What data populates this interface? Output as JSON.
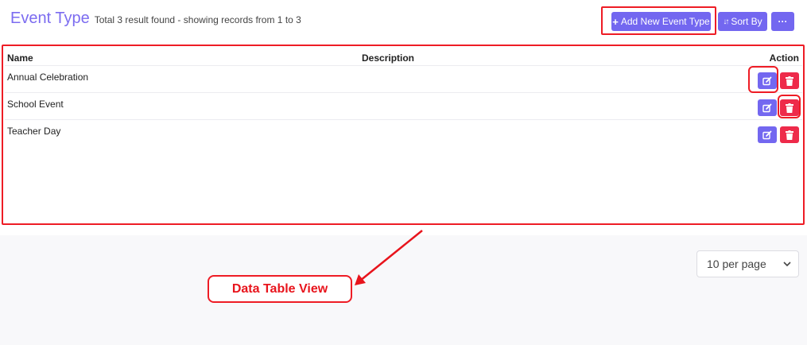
{
  "header": {
    "title": "Event Type",
    "summary": "Total 3 result found - showing records from 1 to 3"
  },
  "toolbar": {
    "add_icon": "+",
    "add_label": "Add New Event Type",
    "sort_icon": "↓↑",
    "sort_label": "Sort By",
    "more_label": "···"
  },
  "table": {
    "columns": {
      "name": "Name",
      "description": "Description",
      "action": "Action"
    },
    "rows": [
      {
        "name": "Annual Celebration",
        "description": ""
      },
      {
        "name": "School Event",
        "description": ""
      },
      {
        "name": "Teacher Day",
        "description": ""
      }
    ]
  },
  "pagination": {
    "per_page": "10 per page"
  },
  "annotation": {
    "label": "Data Table View"
  },
  "colors": {
    "accent": "#7367f0",
    "danger": "#ee2a4a",
    "highlight": "#ee1c25",
    "title": "#7c6cf0"
  }
}
